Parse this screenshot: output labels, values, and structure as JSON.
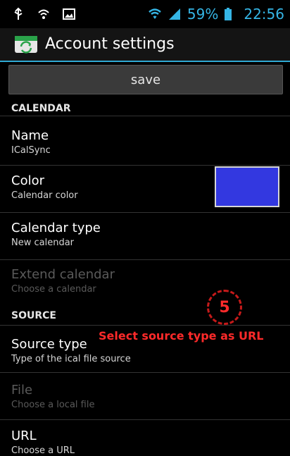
{
  "status_bar": {
    "icons_left": [
      "usb-icon",
      "wifi-settings-icon",
      "image-icon"
    ],
    "battery_percent": "59%",
    "time": "22:56"
  },
  "action_bar": {
    "title": "Account settings",
    "app_icon": "calendar-sync-icon"
  },
  "save": {
    "label": "save"
  },
  "sections": {
    "calendar": "CALENDAR",
    "source": "SOURCE"
  },
  "items": {
    "name": {
      "title": "Name",
      "summary": "ICalSync"
    },
    "color": {
      "title": "Color",
      "summary": "Calendar color",
      "swatch_color": "#3338e0"
    },
    "calendar_type": {
      "title": "Calendar type",
      "summary": "New calendar"
    },
    "extend_calendar": {
      "title": "Extend calendar",
      "summary": "Choose a calendar"
    },
    "source_type": {
      "title": "Source type",
      "summary": "Type of the ical file source"
    },
    "file": {
      "title": "File",
      "summary": "Choose a local file"
    },
    "url": {
      "title": "URL",
      "summary": "Choose a URL"
    }
  },
  "annotation": {
    "step_number": "5",
    "text": "Select source type as URL",
    "color": "#ff2a2a"
  }
}
